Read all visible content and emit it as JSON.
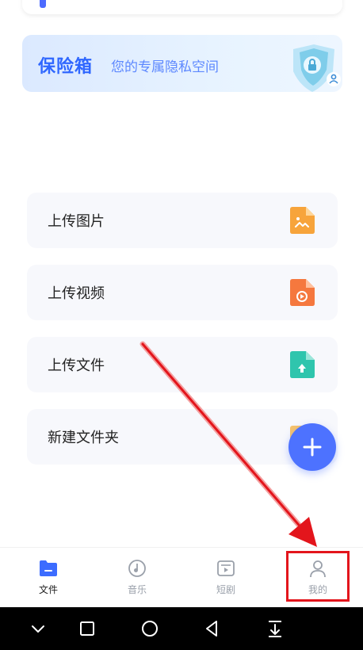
{
  "banner": {
    "text": "",
    "link": ""
  },
  "vault": {
    "title": "保险箱",
    "subtitle": "您的专属隐私空间"
  },
  "upload_menu": [
    {
      "label": "上传图片",
      "icon": "image-file-icon",
      "color": "#f7a43b"
    },
    {
      "label": "上传视频",
      "icon": "video-file-icon",
      "color": "#f5783e"
    },
    {
      "label": "上传文件",
      "icon": "upload-file-icon",
      "color": "#2fc5ad"
    },
    {
      "label": "新建文件夹",
      "icon": "folder-icon",
      "color": "#f7c36b"
    }
  ],
  "fab": {
    "icon": "plus-icon"
  },
  "tabs": [
    {
      "label": "文件",
      "icon": "folder-icon",
      "active": true
    },
    {
      "label": "音乐",
      "icon": "music-disc-icon",
      "active": false
    },
    {
      "label": "短剧",
      "icon": "play-screen-icon",
      "active": false
    },
    {
      "label": "我的",
      "icon": "person-icon",
      "active": false
    }
  ],
  "system_nav": [
    "chevron-down-icon",
    "square-icon",
    "circle-icon",
    "back-triangle-icon",
    "download-bar-icon"
  ],
  "colors": {
    "accent": "#4d72ff",
    "highlight": "#e3151c",
    "card_bg": "#f7f8fc"
  }
}
